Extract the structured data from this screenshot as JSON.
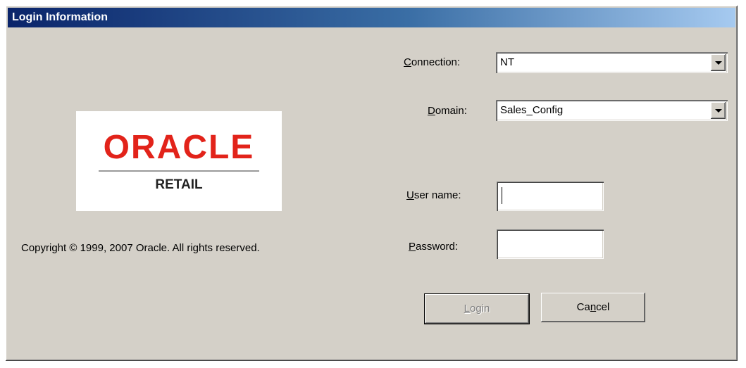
{
  "window": {
    "title": "Login Information"
  },
  "logo": {
    "brand": "ORACLE",
    "product": "RETAIL"
  },
  "copyright": "Copyright © 1999, 2007 Oracle.  All rights reserved.",
  "form": {
    "connection": {
      "label_hotkey": "C",
      "label_rest": "onnection:",
      "value": "NT"
    },
    "domain": {
      "label_hotkey": "D",
      "label_rest": "omain:",
      "value": "Sales_Config"
    },
    "username": {
      "label_hotkey": "U",
      "label_rest": "ser name:",
      "value": ""
    },
    "password": {
      "label_hotkey": "P",
      "label_rest": "assword:",
      "value": ""
    }
  },
  "buttons": {
    "login": {
      "hotkey": "L",
      "rest": "ogin"
    },
    "cancel": {
      "pre": "Ca",
      "hotkey": "n",
      "rest": "cel"
    }
  }
}
